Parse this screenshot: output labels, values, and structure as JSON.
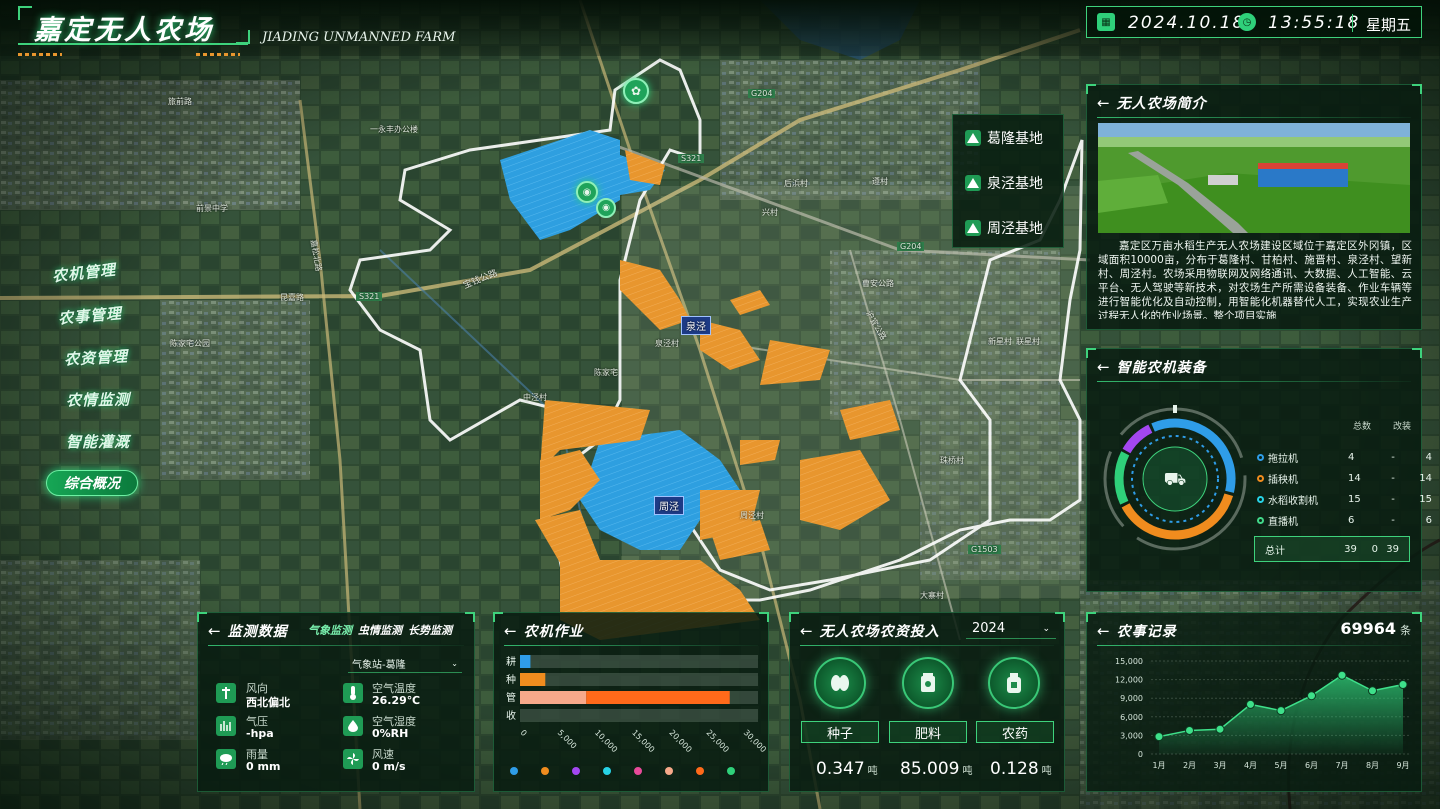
{
  "header": {
    "title": "嘉定无人农场",
    "subtitle": "JIADING UNMANNED FARM",
    "date": "2024.10.18",
    "time": "13:55:18",
    "weekday": "星期五"
  },
  "nav": {
    "items": [
      "农机管理",
      "农事管理",
      "农资管理",
      "农情监测",
      "智能灌溉"
    ],
    "active": "综合概况"
  },
  "bases": {
    "items": [
      "葛隆基地",
      "泉泾基地",
      "周泾基地"
    ]
  },
  "map_labels": {
    "places": [
      "泉泾",
      "周泾",
      "宝钱公路",
      "昆嘉路",
      "曹安公路",
      "嘉松北路",
      "沪宜公路",
      "一永丰办公楼",
      "前景中学",
      "泉泾村",
      "周泾村",
      "宝钱公路",
      "曹王镇",
      "陈家宅",
      "中泾村",
      "旅前路",
      "S321",
      "G204",
      "G1503",
      "S5",
      "S321",
      "X003",
      "后浜村",
      "遵村",
      "兴村",
      "新星村",
      "联星村",
      "珠桥村",
      "陈家宅公园",
      "大寨村"
    ]
  },
  "intro": {
    "title": "无人农场简介",
    "text": "嘉定区万亩水稻生产无人农场建设区域位于嘉定区外冈镇，区域面积10000亩，分布于葛隆村、甘柏村、施晋村、泉泾村、望新村、周泾村。农场采用物联网及网络通讯、大数据、人工智能、云平台、无人驾驶等新技术，对农场生产所需设备装备、作业车辆等进行智能优化及自动控制，用智能化机器替代人工，实现农业生产过程无人化的作业场景。整个项目实施"
  },
  "equipment": {
    "title": "智能农机装备",
    "col_total": "总数",
    "col_modified": "改装",
    "rows": [
      {
        "name": "拖拉机",
        "total": "4",
        "mid": "-",
        "mod": "4",
        "color": "#2f9de8"
      },
      {
        "name": "插秧机",
        "total": "14",
        "mid": "-",
        "mod": "14",
        "color": "#f08c1e"
      },
      {
        "name": "水稻收割机",
        "total": "15",
        "mid": "-",
        "mod": "15",
        "color": "#27d3e6"
      },
      {
        "name": "直播机",
        "total": "6",
        "mid": "-",
        "mod": "6",
        "color": "#42d98a"
      }
    ],
    "summary": {
      "label": "总计",
      "a": "39",
      "b": "0",
      "c": "39"
    },
    "ring": [
      {
        "value": 4,
        "color": "#a347f0"
      },
      {
        "value": 14,
        "color": "#2f9de8"
      },
      {
        "value": 15,
        "color": "#f08c1e"
      },
      {
        "value": 6,
        "color": "#2fd07a"
      }
    ]
  },
  "monitoring": {
    "title": "监测数据",
    "tabs": [
      "气象监测",
      "虫情监测",
      "长势监测"
    ],
    "station": "气象站-葛隆",
    "items": [
      {
        "label": "风向",
        "value": "西北偏北"
      },
      {
        "label": "空气温度",
        "value": "26.29℃"
      },
      {
        "label": "气压",
        "value": "-hpa"
      },
      {
        "label": "空气湿度",
        "value": "0%RH"
      },
      {
        "label": "雨量",
        "value": "0 mm"
      },
      {
        "label": "风速",
        "value": "0 m/s"
      }
    ]
  },
  "operations": {
    "title": "农机作业",
    "categories": [
      "耕",
      "种",
      "管",
      "收"
    ],
    "xticks": [
      "0",
      "5,000",
      "10,000",
      "15,000",
      "20,000",
      "25,000",
      "30,000"
    ],
    "legend_colors": [
      "#2f9de8",
      "#f08c1e",
      "#a347f0",
      "#27d3e6",
      "#e84a9a",
      "#f7a98a",
      "#ff6a1a",
      "#2fd07a"
    ],
    "legend_labels": [
      "",
      "",
      "",
      "",
      "",
      "",
      "",
      ""
    ]
  },
  "inputs": {
    "title": "无人农场农资投入",
    "year": "2024",
    "items": [
      {
        "label": "种子",
        "value": "0.347",
        "unit": "吨"
      },
      {
        "label": "肥料",
        "value": "85.009",
        "unit": "吨"
      },
      {
        "label": "农药",
        "value": "0.128",
        "unit": "吨"
      }
    ]
  },
  "records": {
    "title": "农事记录",
    "total": "69964",
    "unit": "条"
  },
  "chart_data": [
    {
      "type": "bar",
      "orientation": "horizontal",
      "stacked": true,
      "categories": [
        "耕",
        "种",
        "管",
        "收"
      ],
      "series": [
        {
          "values": [
            1400,
            0,
            0,
            0
          ],
          "color": "#2f9de8"
        },
        {
          "values": [
            0,
            3400,
            0,
            0
          ],
          "color": "#f08c1e"
        },
        {
          "values": [
            0,
            0,
            8900,
            0
          ],
          "color": "#f7a98a"
        },
        {
          "values": [
            0,
            0,
            19300,
            0
          ],
          "color": "#ff6a1a"
        }
      ],
      "xlim": [
        0,
        32000
      ],
      "xticks": [
        0,
        5000,
        10000,
        15000,
        20000,
        25000,
        30000
      ],
      "grid": false
    },
    {
      "type": "area",
      "categories": [
        "1月",
        "2月",
        "3月",
        "4月",
        "5月",
        "6月",
        "7月",
        "8月",
        "9月"
      ],
      "values": [
        2800,
        3800,
        4000,
        8000,
        7000,
        9400,
        12700,
        10200,
        11200
      ],
      "ylim": [
        0,
        15000
      ],
      "yticks": [
        0,
        3000,
        6000,
        9000,
        12000,
        15000
      ],
      "grid": true
    }
  ]
}
